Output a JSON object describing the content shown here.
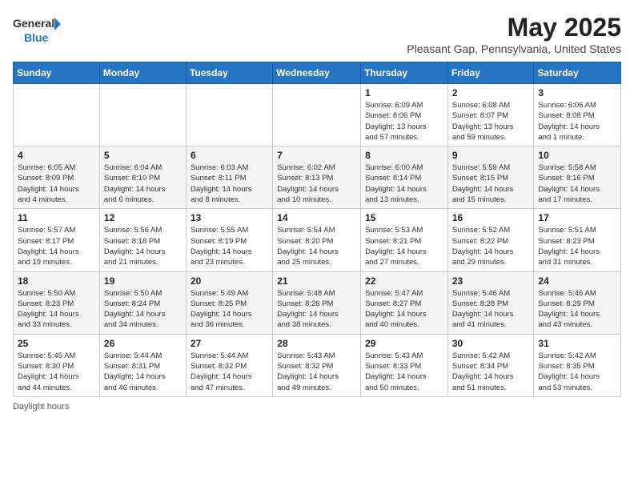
{
  "header": {
    "logo_line1": "General",
    "logo_line2": "Blue",
    "title": "May 2025",
    "subtitle": "Pleasant Gap, Pennsylvania, United States"
  },
  "days_of_week": [
    "Sunday",
    "Monday",
    "Tuesday",
    "Wednesday",
    "Thursday",
    "Friday",
    "Saturday"
  ],
  "weeks": [
    [
      {
        "day": "",
        "info": ""
      },
      {
        "day": "",
        "info": ""
      },
      {
        "day": "",
        "info": ""
      },
      {
        "day": "",
        "info": ""
      },
      {
        "day": "1",
        "info": "Sunrise: 6:09 AM\nSunset: 8:06 PM\nDaylight: 13 hours\nand 57 minutes."
      },
      {
        "day": "2",
        "info": "Sunrise: 6:08 AM\nSunset: 8:07 PM\nDaylight: 13 hours\nand 59 minutes."
      },
      {
        "day": "3",
        "info": "Sunrise: 6:06 AM\nSunset: 8:08 PM\nDaylight: 14 hours\nand 1 minute."
      }
    ],
    [
      {
        "day": "4",
        "info": "Sunrise: 6:05 AM\nSunset: 8:09 PM\nDaylight: 14 hours\nand 4 minutes."
      },
      {
        "day": "5",
        "info": "Sunrise: 6:04 AM\nSunset: 8:10 PM\nDaylight: 14 hours\nand 6 minutes."
      },
      {
        "day": "6",
        "info": "Sunrise: 6:03 AM\nSunset: 8:11 PM\nDaylight: 14 hours\nand 8 minutes."
      },
      {
        "day": "7",
        "info": "Sunrise: 6:02 AM\nSunset: 8:13 PM\nDaylight: 14 hours\nand 10 minutes."
      },
      {
        "day": "8",
        "info": "Sunrise: 6:00 AM\nSunset: 8:14 PM\nDaylight: 14 hours\nand 13 minutes."
      },
      {
        "day": "9",
        "info": "Sunrise: 5:59 AM\nSunset: 8:15 PM\nDaylight: 14 hours\nand 15 minutes."
      },
      {
        "day": "10",
        "info": "Sunrise: 5:58 AM\nSunset: 8:16 PM\nDaylight: 14 hours\nand 17 minutes."
      }
    ],
    [
      {
        "day": "11",
        "info": "Sunrise: 5:57 AM\nSunset: 8:17 PM\nDaylight: 14 hours\nand 19 minutes."
      },
      {
        "day": "12",
        "info": "Sunrise: 5:56 AM\nSunset: 8:18 PM\nDaylight: 14 hours\nand 21 minutes."
      },
      {
        "day": "13",
        "info": "Sunrise: 5:55 AM\nSunset: 8:19 PM\nDaylight: 14 hours\nand 23 minutes."
      },
      {
        "day": "14",
        "info": "Sunrise: 5:54 AM\nSunset: 8:20 PM\nDaylight: 14 hours\nand 25 minutes."
      },
      {
        "day": "15",
        "info": "Sunrise: 5:53 AM\nSunset: 8:21 PM\nDaylight: 14 hours\nand 27 minutes."
      },
      {
        "day": "16",
        "info": "Sunrise: 5:52 AM\nSunset: 8:22 PM\nDaylight: 14 hours\nand 29 minutes."
      },
      {
        "day": "17",
        "info": "Sunrise: 5:51 AM\nSunset: 8:23 PM\nDaylight: 14 hours\nand 31 minutes."
      }
    ],
    [
      {
        "day": "18",
        "info": "Sunrise: 5:50 AM\nSunset: 8:23 PM\nDaylight: 14 hours\nand 33 minutes."
      },
      {
        "day": "19",
        "info": "Sunrise: 5:50 AM\nSunset: 8:24 PM\nDaylight: 14 hours\nand 34 minutes."
      },
      {
        "day": "20",
        "info": "Sunrise: 5:49 AM\nSunset: 8:25 PM\nDaylight: 14 hours\nand 36 minutes."
      },
      {
        "day": "21",
        "info": "Sunrise: 5:48 AM\nSunset: 8:26 PM\nDaylight: 14 hours\nand 38 minutes."
      },
      {
        "day": "22",
        "info": "Sunrise: 5:47 AM\nSunset: 8:27 PM\nDaylight: 14 hours\nand 40 minutes."
      },
      {
        "day": "23",
        "info": "Sunrise: 5:46 AM\nSunset: 8:28 PM\nDaylight: 14 hours\nand 41 minutes."
      },
      {
        "day": "24",
        "info": "Sunrise: 5:46 AM\nSunset: 8:29 PM\nDaylight: 14 hours\nand 43 minutes."
      }
    ],
    [
      {
        "day": "25",
        "info": "Sunrise: 5:45 AM\nSunset: 8:30 PM\nDaylight: 14 hours\nand 44 minutes."
      },
      {
        "day": "26",
        "info": "Sunrise: 5:44 AM\nSunset: 8:31 PM\nDaylight: 14 hours\nand 46 minutes."
      },
      {
        "day": "27",
        "info": "Sunrise: 5:44 AM\nSunset: 8:32 PM\nDaylight: 14 hours\nand 47 minutes."
      },
      {
        "day": "28",
        "info": "Sunrise: 5:43 AM\nSunset: 8:32 PM\nDaylight: 14 hours\nand 49 minutes."
      },
      {
        "day": "29",
        "info": "Sunrise: 5:43 AM\nSunset: 8:33 PM\nDaylight: 14 hours\nand 50 minutes."
      },
      {
        "day": "30",
        "info": "Sunrise: 5:42 AM\nSunset: 8:34 PM\nDaylight: 14 hours\nand 51 minutes."
      },
      {
        "day": "31",
        "info": "Sunrise: 5:42 AM\nSunset: 8:35 PM\nDaylight: 14 hours\nand 53 minutes."
      }
    ]
  ],
  "footer": {
    "daylight_label": "Daylight hours"
  }
}
